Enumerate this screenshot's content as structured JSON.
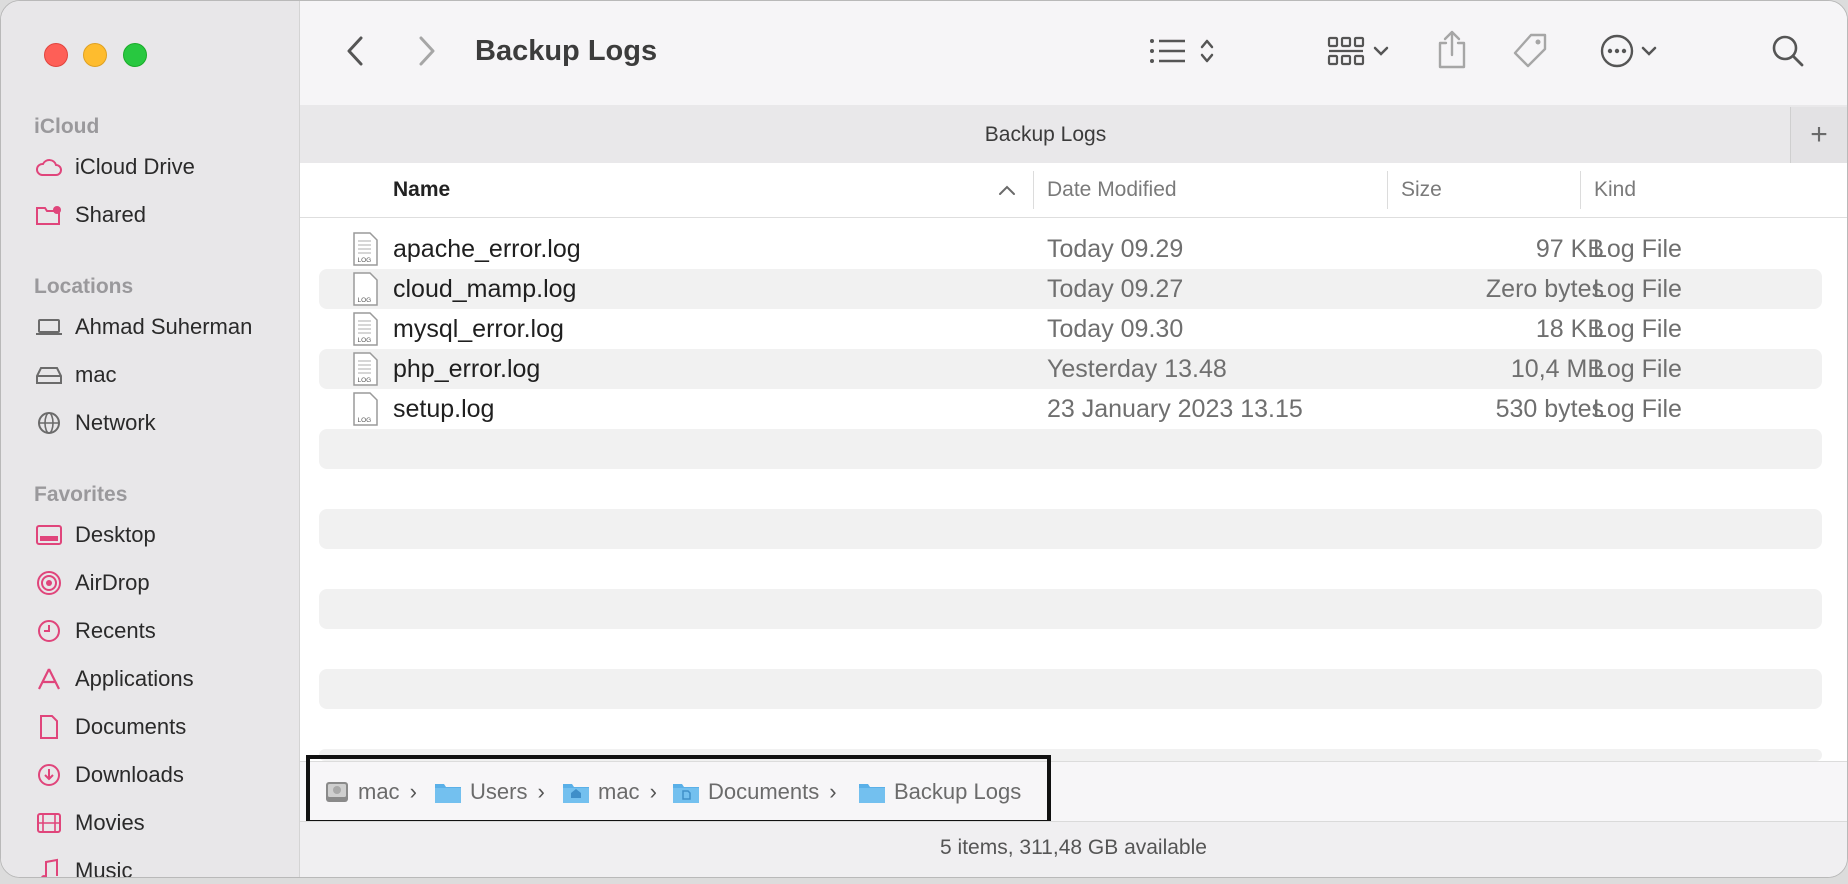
{
  "window": {
    "title": "Backup Logs",
    "tab_title": "Backup Logs",
    "add_tab": "+"
  },
  "sidebar": {
    "sections": [
      {
        "title": "iCloud",
        "items": [
          {
            "label": "iCloud Drive",
            "icon": "cloud-icon"
          },
          {
            "label": "Shared",
            "icon": "shared-folder-icon"
          }
        ]
      },
      {
        "title": "Locations",
        "items": [
          {
            "label": "Ahmad Suherman",
            "icon": "laptop-icon"
          },
          {
            "label": "mac",
            "icon": "disk-icon"
          },
          {
            "label": "Network",
            "icon": "globe-icon"
          }
        ]
      },
      {
        "title": "Favorites",
        "items": [
          {
            "label": "Desktop",
            "icon": "desktop-icon"
          },
          {
            "label": "AirDrop",
            "icon": "airdrop-icon"
          },
          {
            "label": "Recents",
            "icon": "clock-icon"
          },
          {
            "label": "Applications",
            "icon": "applications-icon"
          },
          {
            "label": "Documents",
            "icon": "document-icon"
          },
          {
            "label": "Downloads",
            "icon": "download-icon"
          },
          {
            "label": "Movies",
            "icon": "film-icon"
          },
          {
            "label": "Music",
            "icon": "music-icon"
          }
        ]
      }
    ]
  },
  "columns": {
    "name": "Name",
    "date": "Date Modified",
    "size": "Size",
    "kind": "Kind"
  },
  "files": [
    {
      "name": "apache_error.log",
      "date": "Today 09.29",
      "size": "97 KB",
      "kind": "Log File"
    },
    {
      "name": "cloud_mamp.log",
      "date": "Today 09.27",
      "size": "Zero bytes",
      "kind": "Log File"
    },
    {
      "name": "mysql_error.log",
      "date": "Today 09.30",
      "size": "18 KB",
      "kind": "Log File"
    },
    {
      "name": "php_error.log",
      "date": "Yesterday 13.48",
      "size": "10,4 MB",
      "kind": "Log File"
    },
    {
      "name": "setup.log",
      "date": "23 January 2023 13.15",
      "size": "530 bytes",
      "kind": "Log File"
    }
  ],
  "file_icon_label": "LOG",
  "path": [
    "mac",
    "Users",
    "mac",
    "Documents",
    "Backup Logs"
  ],
  "status": "5 items, 311,48 GB available",
  "colors": {
    "accent": "#e0457b",
    "folder": "#5ab0e8",
    "selected_outline": "#111111"
  }
}
